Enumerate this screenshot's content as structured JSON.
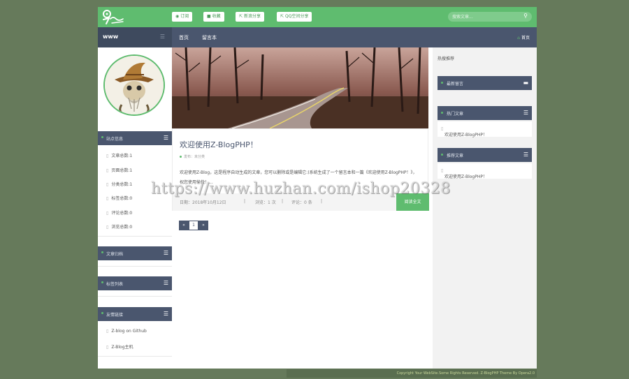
{
  "header": {
    "buttons": [
      {
        "icon": "rss-icon",
        "label": "订阅"
      },
      {
        "icon": "bookmark-icon",
        "label": "收藏"
      },
      {
        "icon": "share-icon",
        "label": "新浪分享"
      },
      {
        "icon": "share-icon",
        "label": "QQ空间分享"
      }
    ],
    "search_placeholder": "搜索文章..."
  },
  "nav": {
    "site_name": "www",
    "items": [
      "首页",
      "留言本"
    ],
    "home_label": "首页"
  },
  "left_sidebar": {
    "site_info_title": "站点信息",
    "stats": [
      "文章总数:1",
      "页面总数:1",
      "分类总数:1",
      "标签总数:0",
      "评论总数:0",
      "浏览总数:0"
    ],
    "archive_title": "文章归档",
    "tags_title": "标签列表",
    "links_title": "友情链接",
    "links": [
      "Z-blog on Github",
      "Z-Blog主机"
    ]
  },
  "post": {
    "title": "欢迎使用Z-BlogPHP！",
    "meta": "发布：未分类",
    "excerpt": "欢迎使用Z-Blog，这是程序自动生成的文章，您可以删除或是编辑它:)系统生成了一个留言本和一篇《欢迎使用Z-BlogPHP！》，祝您使用愉快！...",
    "date": "日期：2018年10月12日",
    "views": "浏览：1 次",
    "comments": "评论：0 条",
    "read_more": "阅读全文"
  },
  "pager": {
    "prev": "«",
    "current": "1",
    "next": "»"
  },
  "right_sidebar": {
    "label": "热搜推荐",
    "latest_comments_title": "最新留言",
    "hot_title": "热门文章",
    "hot_items": [
      "欢迎使用Z-BlogPHP！"
    ],
    "recommend_title": "推荐文章",
    "recommend_items": [
      "欢迎使用Z-BlogPHP！"
    ]
  },
  "footer": {
    "text": "Copyright Your WebSite.Some Rights Reserved. Z-BlogPHP Theme By Opera2.0"
  },
  "watermark": "https://www.huzhan.com/ishop20328",
  "colors": {
    "green": "#5fbc6f",
    "navy": "#4a566e",
    "dark_navy": "#3e4a5e",
    "page_bg": "#667a5b"
  }
}
